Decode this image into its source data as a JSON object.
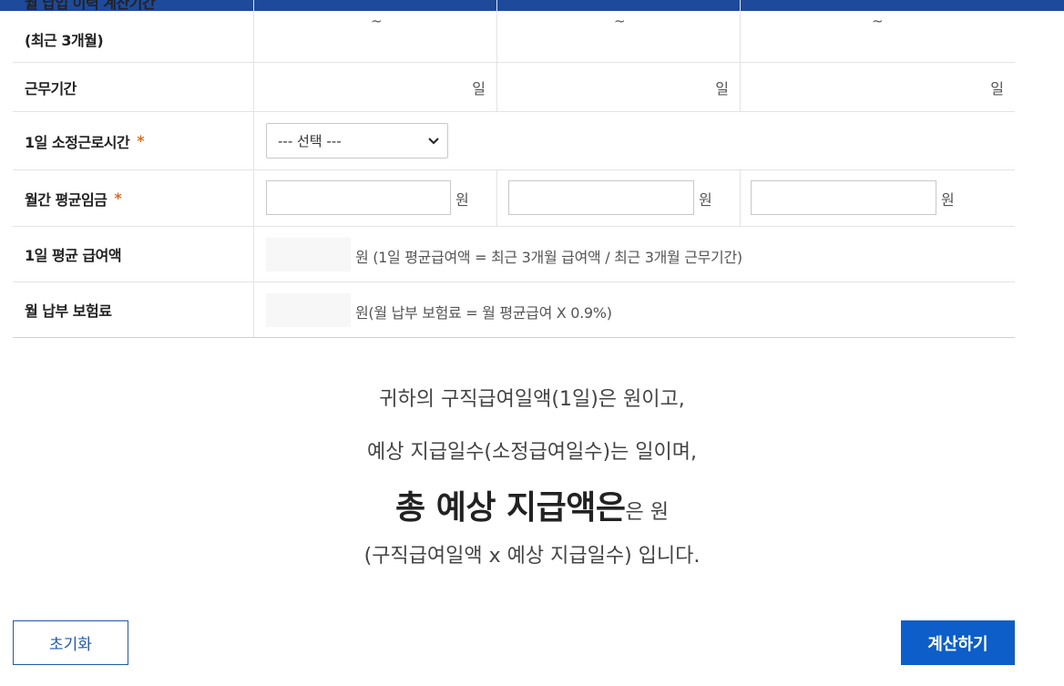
{
  "table": {
    "rows": {
      "period": {
        "label_line1": "월 납입 이력 계산기간",
        "label_line2": "(최근 3개월)",
        "separator": "~"
      },
      "workdays": {
        "label": "근무기간",
        "unit": "일"
      },
      "hours": {
        "label": "1일 소정근로시간",
        "select_value": "--- 선택 ---"
      },
      "wage": {
        "label": "월간 평균임금",
        "unit": "원"
      },
      "daily": {
        "label": "1일 평균 급여액",
        "note": "원 (1일 평균급여액 = 최근 3개월 급여액 / 최근 3개월 근무기간)"
      },
      "premium": {
        "label": "월 납부 보험료",
        "note": "원(월 납부 보험료 = 월 평균급여 X 0.9%)"
      }
    },
    "required_mark": "*"
  },
  "result": {
    "line1": "귀하의 구직급여일액(1일)은 원이고,",
    "line2": "예상 지급일수(소정급여일수)는 일이며,",
    "line3_bold": "총 예상 지급액은",
    "line3_rest": "은 원",
    "line4": "(구직급여일액 x 예상 지급일수) 입니다."
  },
  "buttons": {
    "reset": "초기화",
    "calculate": "계산하기"
  },
  "colors": {
    "topbar": "#1d4a9b",
    "accent": "#0d5ec8",
    "required": "#e06a1c"
  }
}
